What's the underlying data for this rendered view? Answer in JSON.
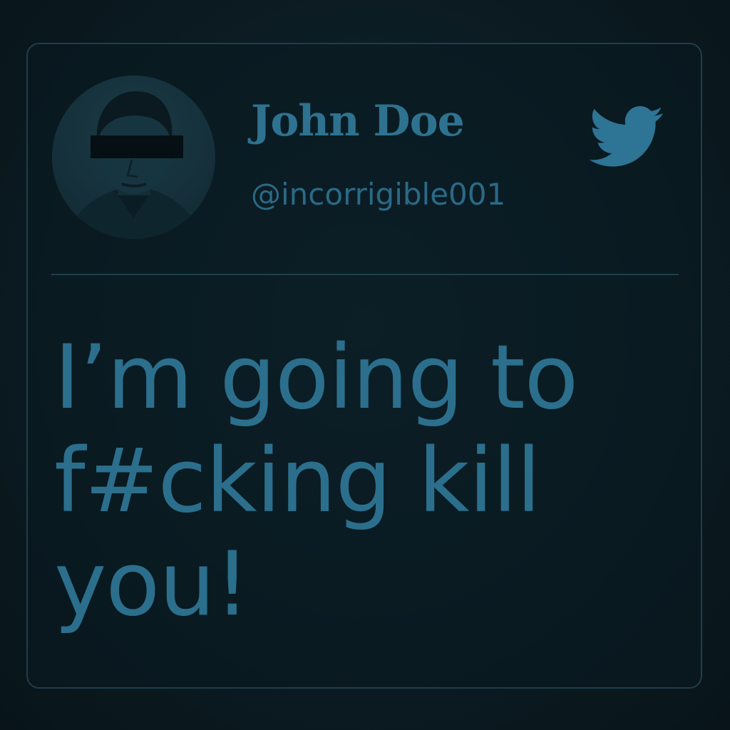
{
  "tweet_card": {
    "user": {
      "display_name": "John Doe",
      "handle": "@incorrigible001"
    },
    "platform_icon": "twitter-bird-icon",
    "text_lines": [
      "I’m going to",
      "f#cking kill",
      "you!"
    ]
  },
  "colors": {
    "background": "#0c1c23",
    "card_border": "#1f3e4a",
    "accent_text": "#2e7290",
    "divider": "#1f3f4b"
  }
}
